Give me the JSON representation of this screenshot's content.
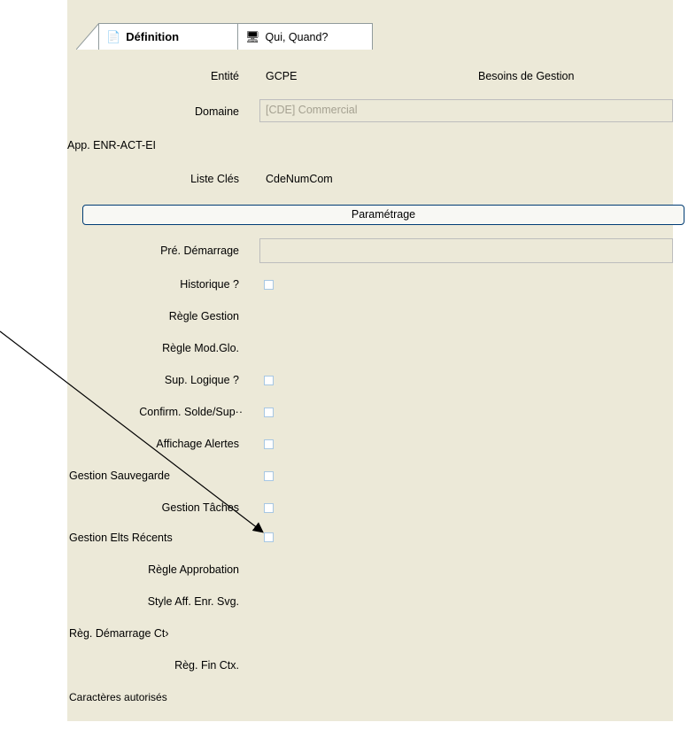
{
  "tabs": [
    {
      "label": "Définition",
      "icon": "document-icon"
    },
    {
      "label": "Qui, Quand?",
      "icon": "users-icon"
    }
  ],
  "form": {
    "entite": {
      "label": "Entité",
      "value": "GCPE",
      "extra": "Besoins de Gestion"
    },
    "domaine": {
      "label": "Domaine",
      "value": "[CDE] Commercial"
    },
    "app": {
      "label": "App. ENR-ACT-EI"
    },
    "liste_cles": {
      "label": "Liste Clés",
      "value": "CdeNumCom"
    },
    "parametrage_button": "Paramétrage",
    "pre_demarrage": {
      "label": "Pré. Démarrage"
    },
    "historique": {
      "label": "Historique ?"
    },
    "regle_gestion": {
      "label": "Règle Gestion"
    },
    "regle_mod_glo": {
      "label": "Règle Mod.Glo."
    },
    "sup_logique": {
      "label": "Sup. Logique ?"
    },
    "confirm_solde": {
      "label": "Confirm. Solde/Sup··"
    },
    "affichage_alertes": {
      "label": "Affichage Alertes"
    },
    "gestion_sauvegarde": {
      "label": "Gestion Sauvegarde"
    },
    "gestion_taches": {
      "label": "Gestion Tâches"
    },
    "gestion_elts_recents": {
      "label": "Gestion Elts Récents"
    },
    "regle_approbation": {
      "label": "Règle Approbation"
    },
    "style_aff": {
      "label": "Style Aff. Enr. Svg."
    },
    "reg_demarrage": {
      "label": "Règ. Démarrage Ct›"
    },
    "reg_fin": {
      "label": "Règ. Fin Ctx."
    },
    "caracteres": {
      "label": "Caractères autorisés"
    }
  }
}
